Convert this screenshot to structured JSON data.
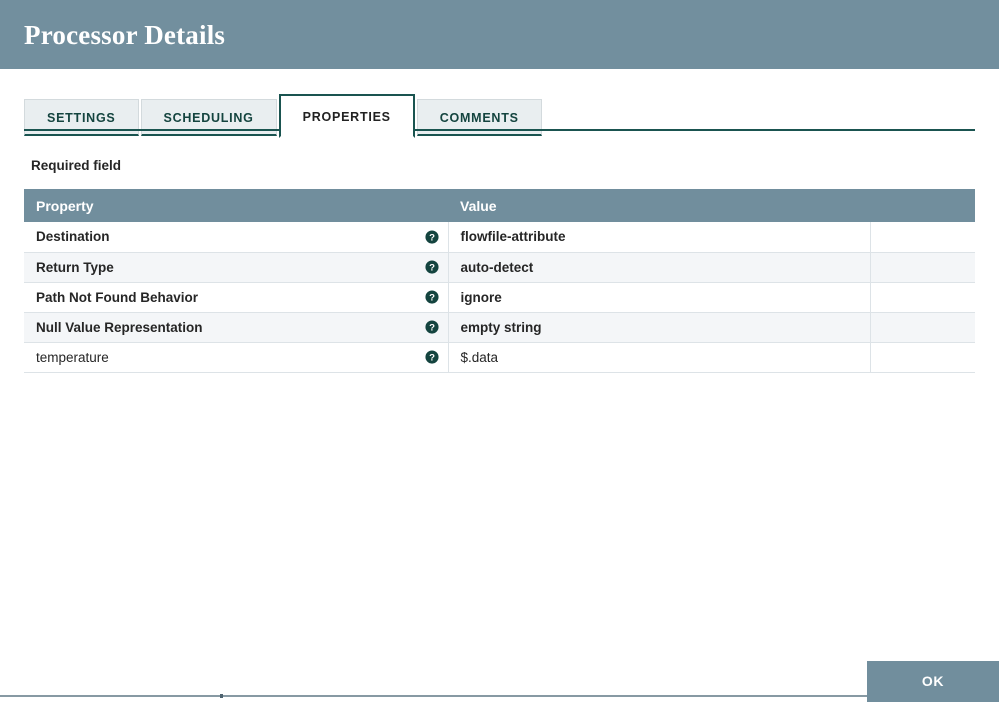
{
  "window": {
    "title": "Processor Details",
    "header_bg": "#728f9e"
  },
  "tabs": [
    {
      "label": "SETTINGS",
      "active": false
    },
    {
      "label": "SCHEDULING",
      "active": false
    },
    {
      "label": "PROPERTIES",
      "active": true
    },
    {
      "label": "COMMENTS",
      "active": false
    }
  ],
  "main": {
    "required_field_label": "Required field",
    "accent_color": "#1a5450",
    "table": {
      "columns": [
        "Property",
        "Value",
        ""
      ],
      "rows": [
        {
          "property": "Destination",
          "value": "flowfile-attribute",
          "required": true,
          "help": "help-icon"
        },
        {
          "property": "Return Type",
          "value": "auto-detect",
          "required": true,
          "help": "help-icon"
        },
        {
          "property": "Path Not Found Behavior",
          "value": "ignore",
          "required": true,
          "help": "help-icon"
        },
        {
          "property": "Null Value Representation",
          "value": "empty string",
          "required": true,
          "help": "help-icon"
        },
        {
          "property": "temperature",
          "value": "$.data",
          "required": false,
          "help": "help-icon"
        }
      ]
    }
  },
  "footer": {
    "ok_label": "OK",
    "ok_bg": "#718e9d"
  }
}
